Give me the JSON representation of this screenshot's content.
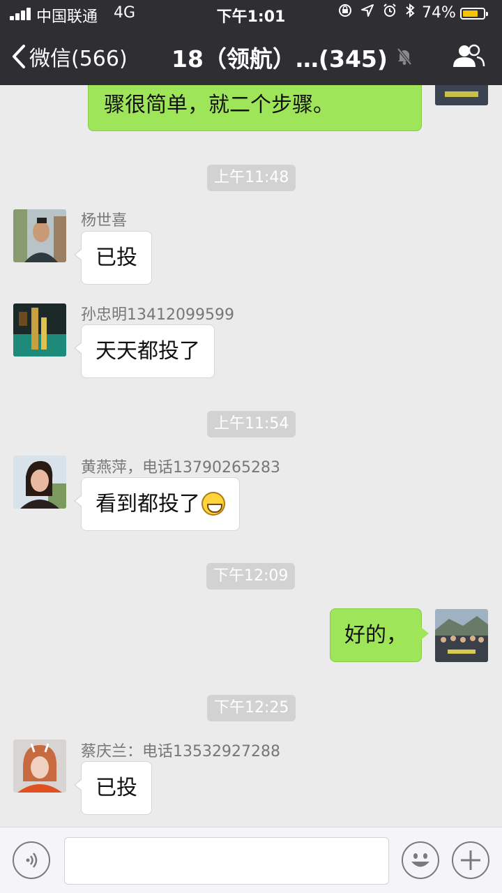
{
  "status_bar": {
    "carrier": "中国联通",
    "network": "4G",
    "time": "下午1:01",
    "battery_percent": "74%",
    "battery_level": 0.74
  },
  "nav": {
    "back_label": "微信(566)",
    "title": "18（领航）…(345)"
  },
  "chat": {
    "messages": [
      {
        "type": "out",
        "text": "骤很简单，就二个步骤。"
      },
      {
        "type": "time",
        "text": "上午11:48"
      },
      {
        "type": "in",
        "sender": "杨世喜",
        "text": "已投"
      },
      {
        "type": "in",
        "sender": "孙忠明13412099599",
        "text": "天天都投了"
      },
      {
        "type": "time",
        "text": "上午11:54"
      },
      {
        "type": "in",
        "sender": "黄燕萍，电话13790265283",
        "text": "看到都投了"
      },
      {
        "type": "time",
        "text": "下午12:09"
      },
      {
        "type": "out",
        "text": "好的，"
      },
      {
        "type": "time",
        "text": "下午12:25"
      },
      {
        "type": "in",
        "sender": "蔡庆兰：电话13532927288",
        "text": "已投"
      }
    ]
  },
  "input": {
    "value": "",
    "placeholder": ""
  },
  "colors": {
    "nav_bg": "#2e2e33",
    "chat_bg": "#ebebeb",
    "outgoing_bubble": "#9fe55a",
    "battery_fill": "#f5c400"
  },
  "icons": [
    "signal-icon",
    "rotation-lock-icon",
    "location-icon",
    "alarm-icon",
    "bluetooth-icon",
    "battery-icon",
    "back-chevron-icon",
    "mute-icon",
    "group-members-icon",
    "voice-icon",
    "emoji-icon",
    "plus-icon",
    "grin-emoji-icon"
  ]
}
